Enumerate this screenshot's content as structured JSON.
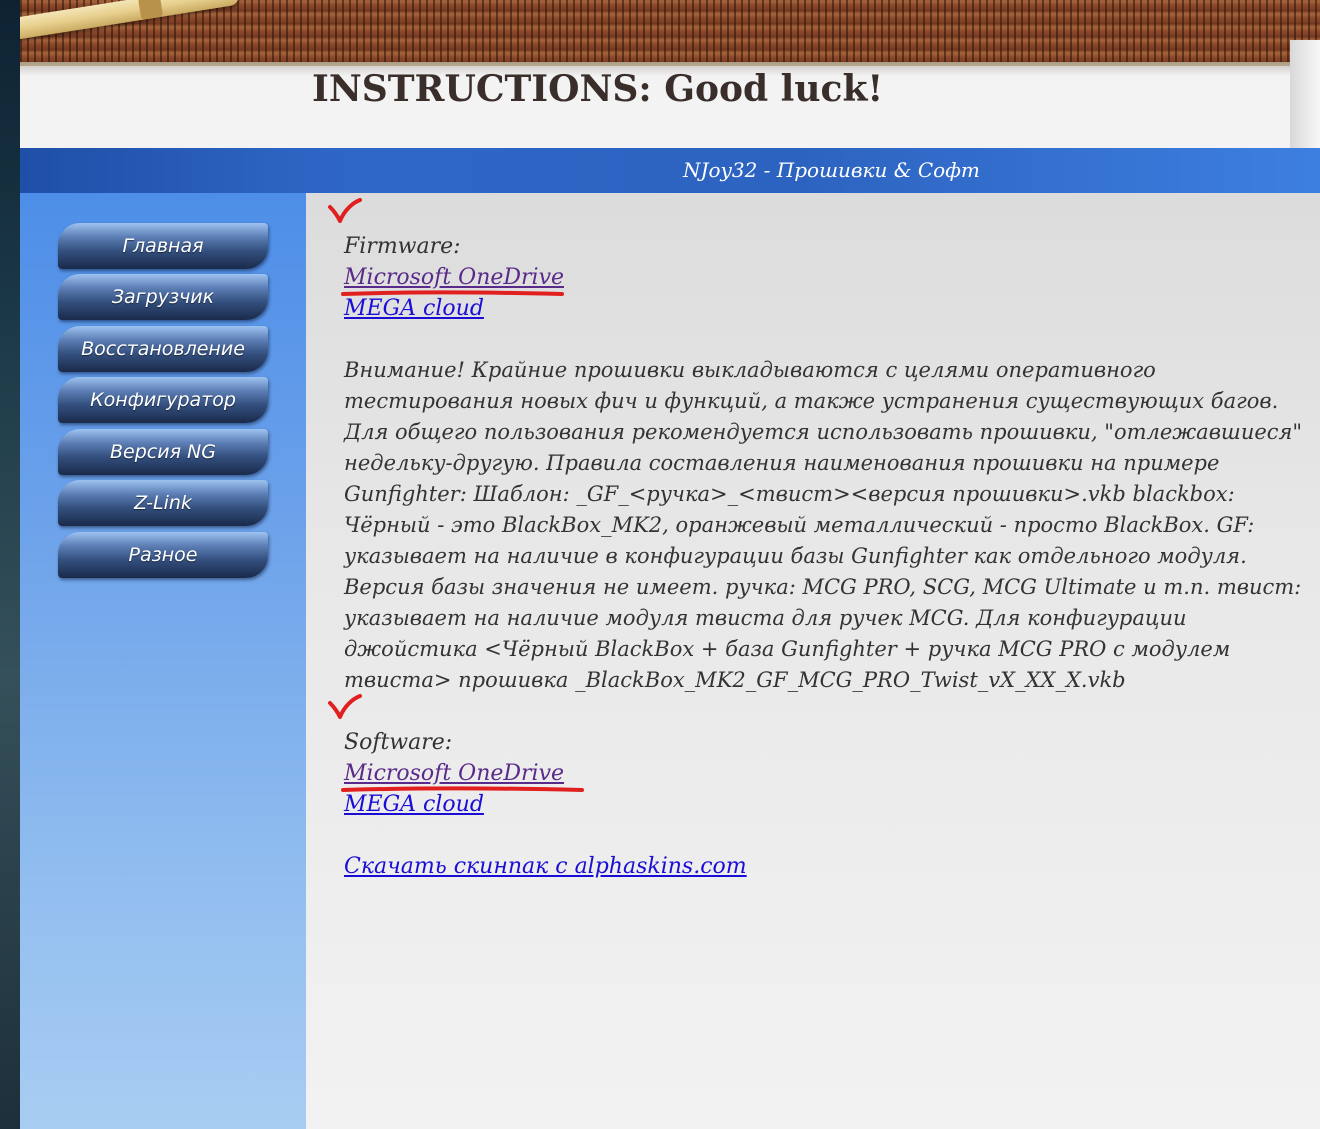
{
  "banner": {
    "title": "INSTRUCTIONS: Good luck!"
  },
  "header": {
    "title": "NJoy32 - Прошивки & Софт"
  },
  "sidebar": {
    "items": [
      {
        "label": "Главная"
      },
      {
        "label": "Загрузчик"
      },
      {
        "label": "Восстановление"
      },
      {
        "label": "Конфигуратор"
      },
      {
        "label": "Версия NG"
      },
      {
        "label": "Z-Link"
      },
      {
        "label": "Разное"
      }
    ]
  },
  "main": {
    "firmware_heading": "Firmware:",
    "firmware_onedrive": "Microsoft OneDrive",
    "firmware_mega": "MEGA cloud",
    "notice": "Внимание! Крайние прошивки выкладываются с целями оперативного тестирования новых фич и функций, а также устранения существующих багов. Для общего пользования рекомендуется использовать прошивки, \"отлежавшиеся\" недельку-другую. Правила составления наименования прошивки на примере Gunfighter: Шаблон: _GF_<ручка>_<твист><версия прошивки>.vkb blackbox: Чёрный - это BlackBox_MK2, оранжевый металлический - просто BlackBox. GF: указывает на наличие в конфигурации базы Gunfighter как отдельного модуля. Версия базы значения не имеет. ручка: MCG PRO, SCG, MCG Ultimate и т.п. твист: указывает на наличие модуля твиста для ручек MCG. Для конфигурации джойстика <Чёрный BlackBox + база Gunfighter + ручка MCG PRO с модулем твиста> прошивка _BlackBox_MK2_GF_MCG_PRO_Twist_vX_XX_X.vkb",
    "software_heading": "Software:",
    "software_onedrive": "Microsoft OneDrive",
    "software_mega": "MEGA cloud",
    "skinpack_link": "Скачать скинпак с alphaskins.com"
  },
  "colors": {
    "header_bar": "#2d63c0",
    "link": "#1a0dd6",
    "visited_link": "#5a2a8a",
    "annotation": "#e0201e"
  }
}
